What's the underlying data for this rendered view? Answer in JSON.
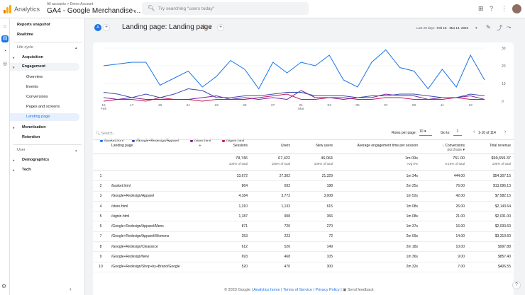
{
  "app": {
    "name": "Analytics",
    "account_crumb": "All accounts > Demo Account",
    "property": "GA4 - Google Merchandise ...",
    "search_placeholder": "Try searching \"users today\""
  },
  "sidebar": {
    "items": [
      {
        "label": "Reports snapshot",
        "bold": true
      },
      {
        "label": "Realtime",
        "bold": true
      },
      {
        "label": "Life cycle",
        "section": true
      },
      {
        "label": "Acquisition",
        "bold": true
      },
      {
        "label": "Engagement",
        "bold": true
      },
      {
        "label": "Overview"
      },
      {
        "label": "Events"
      },
      {
        "label": "Conversions"
      },
      {
        "label": "Pages and screens"
      },
      {
        "label": "Landing page",
        "active": true
      },
      {
        "label": "Monetization",
        "bold": true
      },
      {
        "label": "Retention",
        "bold": true
      },
      {
        "label": "User",
        "section": true
      },
      {
        "label": "Demographics",
        "bold": true
      },
      {
        "label": "Tech",
        "bold": true
      }
    ]
  },
  "report": {
    "badge": "A",
    "title": "Landing page: Landing page",
    "date_label": "Last 28 days",
    "date_range": "Feb 15 - Mar 14, 2023"
  },
  "chart_data": {
    "type": "line",
    "x": [
      "15 Feb",
      "16",
      "17",
      "18",
      "19",
      "20",
      "21",
      "22",
      "23",
      "24",
      "25",
      "26",
      "27",
      "28",
      "01 Mar",
      "02",
      "03",
      "04",
      "05",
      "06",
      "07",
      "08",
      "09",
      "10",
      "11",
      "12",
      "13",
      "14"
    ],
    "x_tick_labels": [
      "15\nFeb",
      "17",
      "19",
      "21",
      "23",
      "25",
      "27",
      "01\nMar",
      "03",
      "05",
      "07",
      "09",
      "11",
      "13"
    ],
    "ylim_right": [
      0,
      30
    ],
    "y_ticks_right": [
      "30",
      "20",
      "10",
      "0"
    ],
    "grid": true,
    "legend_position": "bottom-left",
    "series": [
      {
        "name": "/basket.html",
        "color": "#1a73e8",
        "values": [
          20,
          21,
          22,
          22,
          9,
          13,
          17,
          8,
          14,
          23,
          18,
          7,
          22,
          16,
          22,
          20,
          26,
          12,
          8,
          22,
          29,
          19,
          17,
          7,
          18,
          8,
          26,
          12
        ]
      },
      {
        "name": "/Google+Redesign/Apparel",
        "color": "#3949ab",
        "values": [
          5,
          4,
          2,
          4,
          2,
          4,
          7,
          6,
          2,
          2,
          3,
          3,
          4,
          5,
          5,
          3,
          3,
          3,
          2,
          3,
          3,
          4,
          4,
          3,
          2,
          2,
          4,
          3
        ]
      },
      {
        "name": "/store.html",
        "color": "#7b1fa2",
        "values": [
          2,
          1,
          2,
          1,
          1,
          1,
          1,
          2,
          3,
          1,
          2,
          1,
          2,
          1,
          6,
          2,
          2,
          1,
          2,
          2,
          4,
          3,
          3,
          1,
          2,
          2,
          3,
          1
        ]
      },
      {
        "name": "/signin.html",
        "color": "#c2185b",
        "values": [
          0,
          1,
          1,
          0,
          2,
          1,
          1,
          0,
          1,
          1,
          1,
          2,
          3,
          4,
          1,
          1,
          2,
          2,
          1,
          1,
          2,
          2,
          1,
          1,
          1,
          2,
          1,
          1
        ]
      }
    ]
  },
  "table": {
    "search_placeholder": "Search...",
    "rows_per_page_label": "Rows per page:",
    "rows_per_page": "10",
    "goto_label": "Go to:",
    "goto_value": "1",
    "pager": "1-10 of 114",
    "columns": [
      "Landing page",
      "Sessions",
      "Users",
      "New users",
      "Average engagement time per session",
      "Conversions",
      "Total revenue"
    ],
    "conversions_sub": "purchase",
    "totals": {
      "sessions": "78,746",
      "sessions_sub": "100% of total",
      "users": "67,422",
      "users_sub": "100% of total",
      "new_users": "46,064",
      "new_users_sub": "100% of total",
      "engagement": "1m 09s",
      "engagement_sub": "Avg 0%",
      "conversions": "751.00",
      "conversions_sub": "0.15% of total",
      "revenue": "$99,659.37",
      "revenue_sub": "100% of total"
    },
    "rows": [
      {
        "n": "1",
        "page": "",
        "sessions": "33,672",
        "users": "27,302",
        "new": "21,329",
        "eng": "1m 34s",
        "conv": "444.00",
        "rev": "$54,307.15"
      },
      {
        "n": "2",
        "page": "/basket.html",
        "sessions": "864",
        "users": "692",
        "new": "188",
        "eng": "2m 25s",
        "conv": "76.00",
        "rev": "$13,096.13"
      },
      {
        "n": "3",
        "page": "/Google+Redesign/Apparel",
        "sessions": "4,184",
        "users": "3,772",
        "new": "3,008",
        "eng": "1m 52s",
        "conv": "42.00",
        "rev": "$7,582.15"
      },
      {
        "n": "4",
        "page": "/store.html",
        "sessions": "1,310",
        "users": "1,133",
        "new": "615",
        "eng": "1m 08s",
        "conv": "26.00",
        "rev": "$2,143.64"
      },
      {
        "n": "5",
        "page": "/signin.html",
        "sessions": "1,187",
        "users": "908",
        "new": "366",
        "eng": "1m 08s",
        "conv": "21.00",
        "rev": "$2,031.00"
      },
      {
        "n": "6",
        "page": "/Google+Redesign/Apparel/Mens",
        "sessions": "871",
        "users": "720",
        "new": "270",
        "eng": "1m 37s",
        "conv": "16.00",
        "rev": "$2,033.60"
      },
      {
        "n": "7",
        "page": "/Google+Redesign/Apparel/Womens",
        "sessions": "253",
        "users": "223",
        "new": "72",
        "eng": "2m 09s",
        "conv": "14.00",
        "rev": "$3,310.60"
      },
      {
        "n": "8",
        "page": "/Google+Redesign/Clearance",
        "sessions": "612",
        "users": "526",
        "new": "149",
        "eng": "2m 18s",
        "conv": "10.00",
        "rev": "$997.88"
      },
      {
        "n": "9",
        "page": "/Google+Redesign/New",
        "sessions": "693",
        "users": "468",
        "new": "105",
        "eng": "1m 36s",
        "conv": "9.00",
        "rev": "$857.40"
      },
      {
        "n": "10",
        "page": "/Google+Redesign/Shop+by+Brand/Google",
        "sessions": "520",
        "users": "470",
        "new": "300",
        "eng": "2m 32s",
        "conv": "7.00",
        "rev": "$406.55"
      }
    ]
  },
  "footer": {
    "copyright": "© 2023 Google",
    "links": [
      "Analytics home",
      "Terms of Service",
      "Privacy Policy"
    ],
    "feedback": "Send feedback"
  }
}
